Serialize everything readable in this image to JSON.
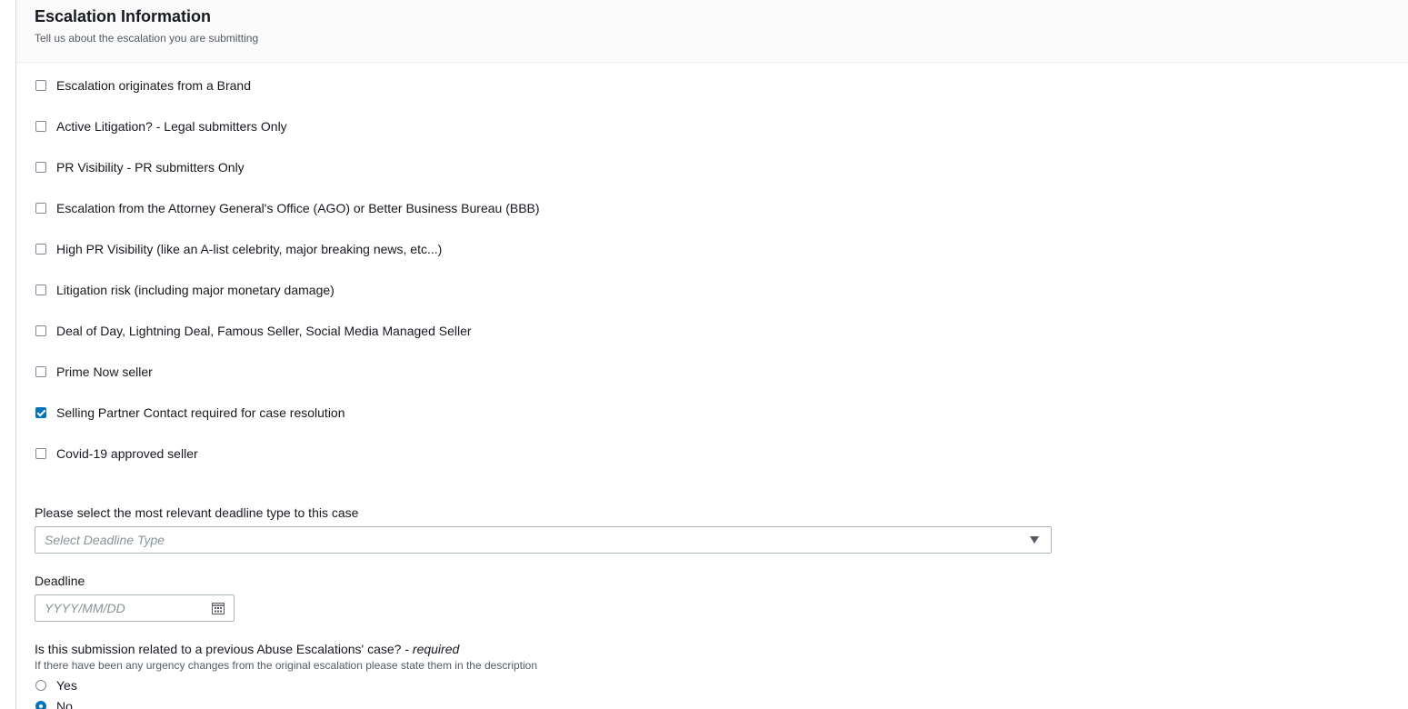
{
  "panel": {
    "title": "Escalation Information",
    "subtitle": "Tell us about the escalation you are submitting"
  },
  "checkboxes": [
    {
      "label": "Escalation originates from a Brand",
      "checked": false
    },
    {
      "label": "Active Litigation? - Legal submitters Only",
      "checked": false
    },
    {
      "label": "PR Visibility - PR submitters Only",
      "checked": false
    },
    {
      "label": "Escalation from the Attorney General's Office (AGO) or Better Business Bureau (BBB)",
      "checked": false
    },
    {
      "label": "High PR Visibility (like an A-list celebrity, major breaking news, etc...)",
      "checked": false
    },
    {
      "label": "Litigation risk (including major monetary damage)",
      "checked": false
    },
    {
      "label": "Deal of Day, Lightning Deal, Famous Seller, Social Media Managed Seller",
      "checked": false
    },
    {
      "label": "Prime Now seller",
      "checked": false
    },
    {
      "label": "Selling Partner Contact required for case resolution",
      "checked": true
    },
    {
      "label": "Covid-19 approved seller",
      "checked": false
    }
  ],
  "deadline_type": {
    "label": "Please select the most relevant deadline type to this case",
    "placeholder": "Select Deadline Type"
  },
  "deadline": {
    "label": "Deadline",
    "placeholder": "YYYY/MM/DD"
  },
  "previous_case": {
    "question": "Is this submission related to a previous Abuse Escalations' case?",
    "required_suffix": " - ",
    "required_text": "required",
    "description": "If there have been any urgency changes from the original escalation please state them in the description",
    "options": [
      {
        "label": "Yes",
        "selected": false
      },
      {
        "label": "No",
        "selected": true
      }
    ]
  },
  "colors": {
    "accent": "#0073bb",
    "header_bg": "#fafafa",
    "text": "#16191f",
    "muted": "#545b64"
  }
}
